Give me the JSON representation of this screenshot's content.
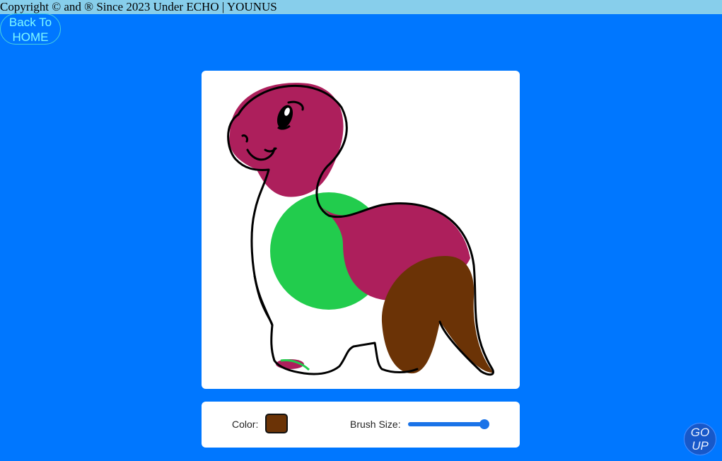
{
  "header": {
    "copyright": "Copyright © and ® Since 2023 Under ECHO | YOUNUS"
  },
  "nav": {
    "back_line1": "Back To",
    "back_line2": "HOME"
  },
  "controls": {
    "color_label": "Color:",
    "selected_color": "#6b3306",
    "brush_label": "Brush Size:",
    "brush_size_fraction": 1.0
  },
  "footer": {
    "go_line1": "GO",
    "go_line2": "UP"
  },
  "colors": {
    "page_background": "#0077ff",
    "header_background": "#87ceeb",
    "paint_magenta": "#ad1f5c",
    "paint_green": "#22cc4d",
    "paint_brown": "#6b3306"
  }
}
